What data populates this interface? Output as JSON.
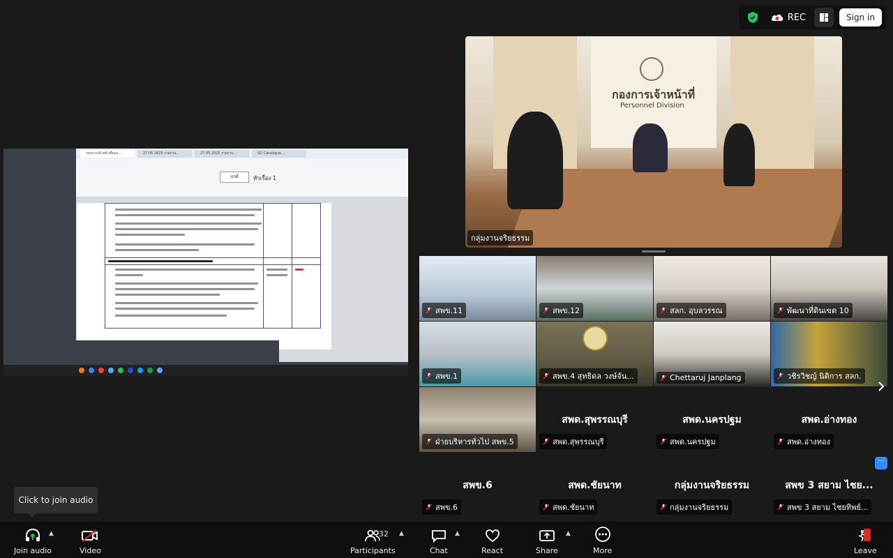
{
  "top": {
    "rec_label": "REC",
    "signin_label": "Sign in"
  },
  "share": {
    "tabs": [
      "กองการเจ้าหน้าที่ของ...",
      "27 05 2025 รายงาน...",
      "27 05 2025 รายงาน...",
      "SD Catalogue..."
    ],
    "style_normal": "ปกติ",
    "style_heading": "หัวเรื่อง 1"
  },
  "speaker": {
    "sign_th": "กองการเจ้าหน้าที่",
    "sign_en": "Personnel Division",
    "name": "กลุ่มงานจริยธรรม"
  },
  "tiles": [
    {
      "name": "สพข.11"
    },
    {
      "name": "สพข.12"
    },
    {
      "name": "สลก. อุบลวรรณ"
    },
    {
      "name": "พัฒนาที่ดินเขต 10"
    },
    {
      "name": "สพข.1"
    },
    {
      "name": "สพข.4 สุทธิดล วงษ์จัน..."
    },
    {
      "name": "Chettaruj Janplang"
    },
    {
      "name": "วชิรวิชญ์ นิติการ สลก."
    },
    {
      "name": "ฝ่ายบริหารทั่วไป สพข.5"
    },
    {
      "name": "สพด.สุพรรณบุรี",
      "big": "สพด.สุพรรณบุรี"
    },
    {
      "name": "สพด.นครปฐม",
      "big": "สพด.นครปฐม"
    },
    {
      "name": "สพด.อ่างทอง",
      "big": "สพด.อ่างทอง"
    },
    {
      "name": "สพข.6",
      "big": "สพข.6"
    },
    {
      "name": "สพด.ชัยนาท",
      "big": "สพด.ชัยนาท"
    },
    {
      "name": "กลุ่มงานจริยธรรม",
      "big": "กลุ่มงานจริยธรรม"
    },
    {
      "name": "สพข 3 สยาม ไชยทิพย์...",
      "big": "สพข 3 สยาม ไชย..."
    }
  ],
  "tooltip": "Click to join audio",
  "toolbar": {
    "join_audio": "Join audio",
    "video": "Video",
    "participants": "Participants",
    "participants_count": "32",
    "chat": "Chat",
    "react": "React",
    "share": "Share",
    "more": "More",
    "leave": "Leave"
  },
  "colors": {
    "accent": "#2d8cff",
    "leave": "#e02828",
    "shield": "#22c55e"
  }
}
